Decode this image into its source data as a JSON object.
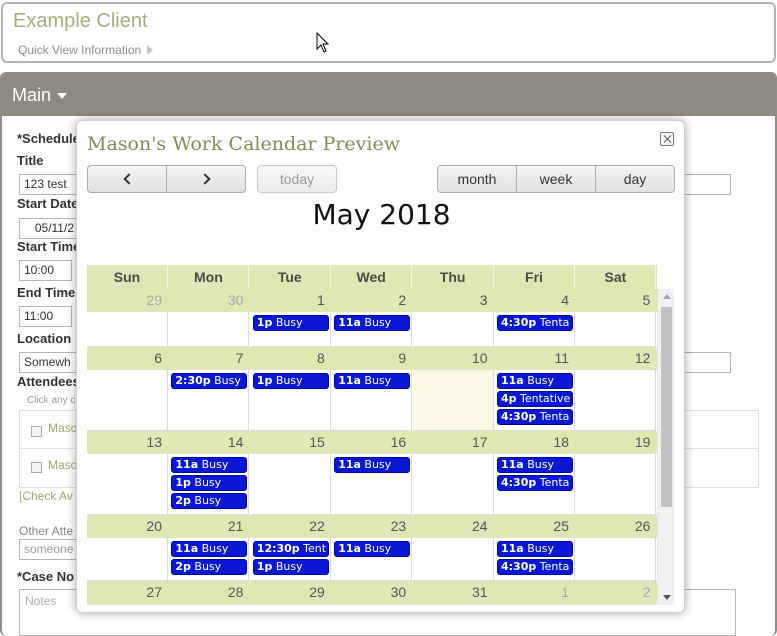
{
  "client": {
    "name": "Example Client",
    "quick_view": "Quick View Information"
  },
  "main": {
    "header": "Main",
    "schedule_label": "*Schedule",
    "title_label": "Title",
    "title_value": "123 test",
    "start_date_label": "Start Date",
    "start_date_value": "05/11/2",
    "start_time_label": "Start Time",
    "start_time_value": "10:00",
    "end_time_label": "End Time",
    "end_time_value": "11:00",
    "location_label": "Location",
    "location_value": "Somewh",
    "attendees_label": "Attendees",
    "attendees_note": "Click any c",
    "attendee_1": "Maso",
    "attendee_2": "Maso",
    "check_availability": "[Check Av",
    "other_attendees_label": "Other Atte",
    "other_attendees_placeholder": "someone",
    "case_notes_label": "*Case No",
    "notes_placeholder": "Notes"
  },
  "modal": {
    "title": "Mason's Work Calendar Preview",
    "today": "today",
    "month": "month",
    "week": "week",
    "day": "day",
    "heading": "May 2018",
    "weekdays": [
      "Sun",
      "Mon",
      "Tue",
      "Wed",
      "Thu",
      "Fri",
      "Sat"
    ]
  },
  "calendar": {
    "weeks": [
      {
        "days": [
          "29",
          "30",
          "1",
          "2",
          "3",
          "4",
          "5"
        ],
        "other": [
          true,
          true,
          false,
          false,
          false,
          false,
          false
        ],
        "events": [
          {
            "day": 2,
            "slot": 0,
            "time": "1p",
            "label": "Busy"
          },
          {
            "day": 3,
            "slot": 0,
            "time": "11a",
            "label": "Busy"
          },
          {
            "day": 5,
            "slot": 0,
            "time": "4:30p",
            "label": "Tenta"
          }
        ]
      },
      {
        "days": [
          "6",
          "7",
          "8",
          "9",
          "10",
          "11",
          "12"
        ],
        "other": [
          false,
          false,
          false,
          false,
          false,
          false,
          false
        ],
        "events": [
          {
            "day": 1,
            "slot": 0,
            "time": "2:30p",
            "label": "Busy"
          },
          {
            "day": 2,
            "slot": 0,
            "time": "1p",
            "label": "Busy"
          },
          {
            "day": 3,
            "slot": 0,
            "time": "11a",
            "label": "Busy"
          },
          {
            "day": 5,
            "slot": 0,
            "time": "11a",
            "label": "Busy"
          },
          {
            "day": 5,
            "slot": 1,
            "time": "4p",
            "label": "Tentative"
          },
          {
            "day": 5,
            "slot": 2,
            "time": "4:30p",
            "label": "Tenta"
          }
        ]
      },
      {
        "days": [
          "13",
          "14",
          "15",
          "16",
          "17",
          "18",
          "19"
        ],
        "other": [
          false,
          false,
          false,
          false,
          false,
          false,
          false
        ],
        "events": [
          {
            "day": 1,
            "slot": 0,
            "time": "11a",
            "label": "Busy"
          },
          {
            "day": 1,
            "slot": 1,
            "time": "1p",
            "label": "Busy"
          },
          {
            "day": 1,
            "slot": 2,
            "time": "2p",
            "label": "Busy"
          },
          {
            "day": 3,
            "slot": 0,
            "time": "11a",
            "label": "Busy"
          },
          {
            "day": 5,
            "slot": 0,
            "time": "11a",
            "label": "Busy"
          },
          {
            "day": 5,
            "slot": 1,
            "time": "4:30p",
            "label": "Tenta"
          }
        ]
      },
      {
        "days": [
          "20",
          "21",
          "22",
          "23",
          "24",
          "25",
          "26"
        ],
        "other": [
          false,
          false,
          false,
          false,
          false,
          false,
          false
        ],
        "events": [
          {
            "day": 1,
            "slot": 0,
            "time": "11a",
            "label": "Busy"
          },
          {
            "day": 1,
            "slot": 1,
            "time": "2p",
            "label": "Busy"
          },
          {
            "day": 2,
            "slot": 0,
            "time": "12:30p",
            "label": "Tent"
          },
          {
            "day": 2,
            "slot": 1,
            "time": "1p",
            "label": "Busy"
          },
          {
            "day": 3,
            "slot": 0,
            "time": "11a",
            "label": "Busy"
          },
          {
            "day": 5,
            "slot": 0,
            "time": "11a",
            "label": "Busy"
          },
          {
            "day": 5,
            "slot": 1,
            "time": "4:30p",
            "label": "Tenta"
          }
        ]
      },
      {
        "days": [
          "27",
          "28",
          "29",
          "30",
          "31",
          "1",
          "2"
        ],
        "other": [
          false,
          false,
          false,
          false,
          false,
          true,
          true
        ],
        "events": []
      }
    ]
  },
  "colors": {
    "accent_green": "#a3b07c",
    "event_blue": "#0a18d6",
    "header_bar": "#8e8a80",
    "day_header": "#e1e6b5",
    "today_highlight": "#fcf8e3"
  }
}
